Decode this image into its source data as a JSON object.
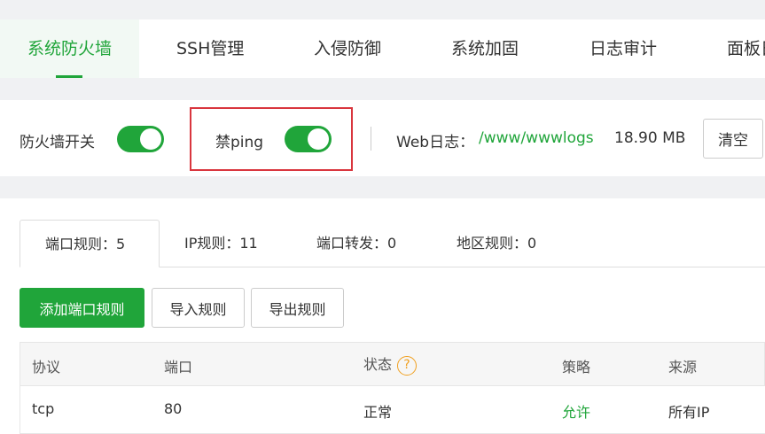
{
  "topnav": {
    "tabs": [
      "系统防火墙",
      "SSH管理",
      "入侵防御",
      "系统加固",
      "日志审计",
      "面板日志"
    ]
  },
  "switchbar": {
    "firewall_label": "防火墙开关",
    "firewall_on": true,
    "ping_label": "禁ping",
    "ping_on": true,
    "weblog_label": "Web日志：",
    "weblog_path": "/www/wwwlogs",
    "weblog_size": "18.90 MB",
    "clear_label": "清空"
  },
  "subtabs": [
    "端口规则：5",
    "IP规则：11",
    "端口转发：0",
    "地区规则：0"
  ],
  "toolbar": {
    "add_label": "添加端口规则",
    "import_label": "导入规则",
    "export_label": "导出规则"
  },
  "table": {
    "columns": [
      "协议",
      "端口",
      "状态",
      "策略",
      "来源"
    ],
    "status_help": "?",
    "rows": [
      [
        "tcp",
        "80",
        "正常",
        "允许",
        "所有IP"
      ]
    ]
  },
  "colors": {
    "accent": "#20a53a",
    "highlight": "#d9363e",
    "help": "#f0a020"
  }
}
